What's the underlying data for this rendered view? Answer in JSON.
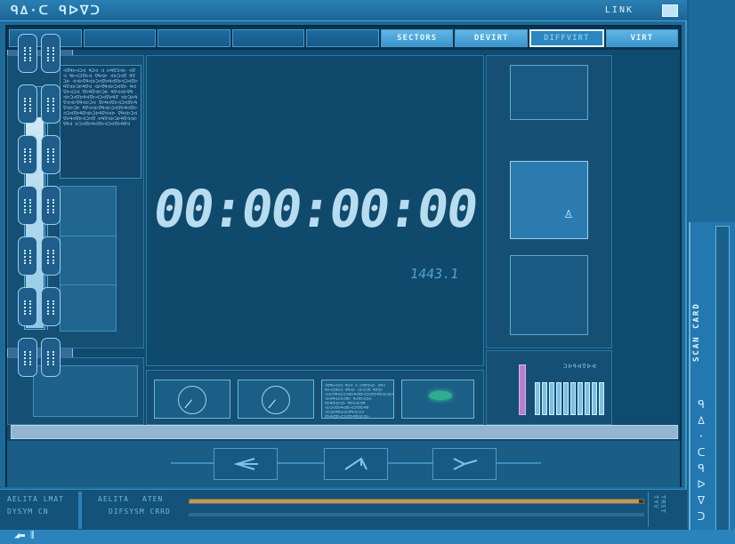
{
  "titlebar": {
    "glyphs_left": "ᑫ∆·ᑕ ᑫᐅᐁᑐ",
    "link_label": "LINK"
  },
  "tabs": [
    {
      "label": "",
      "state": "empty"
    },
    {
      "label": "",
      "state": "empty"
    },
    {
      "label": "",
      "state": "empty"
    },
    {
      "label": "",
      "state": "empty"
    },
    {
      "label": "",
      "state": "empty"
    },
    {
      "label": "SECTORS",
      "state": "lit"
    },
    {
      "label": "DEVIRT",
      "state": "lit"
    },
    {
      "label": "DIFFVIRT",
      "state": "active"
    },
    {
      "label": "VIRT",
      "state": "lit"
    }
  ],
  "left": {
    "gauge_level": 0.87,
    "data_text": "ᐊᐁᑫᐅᐊᑐᐊ ᑫᑐᐊ ᐊ ᐅᑫᐁᑐᐊᐅ ᐊᐁᐊ ᑫᐅᐊᑐᐁᐅᐊ ᐁᑫᐊᐅ ᐊᐅᑐᐊᐁ ᑫᐁᑐᐅ ᐊᐊᐅᐁᑫᐊᐅᑐᐊᐁᐅᑫᐊᐁᐅᐊᑐᐊᐁᐅᑫᐁᐊᐅᑐᐅᑫᐁᐊ ᐊᐅᐁᑫᐊᐅᑐᐊᐁᐅ ᑫᐊᐁᐅᐊᑐᐊ ᐁᐅᑫᐁᐊᐅᑐᐅ ᑫᐁᐊᐊᐅᐁᑫ ᐊᐅᑐᐊᐁᐅᑫᐊᐁᐅᐊᑐᐊᐁᐅᑫᐁ ᐊᐅᑐᐅᑫᐁᐊᐊᐅᐁᑫᐊᐅᑐᐊ ᐁᐅᑫᐊᐁᐅᐊᑐᐊᐁᐅᑫᐁᐊᐅᑐᐅ ᑫᐁᐊᐊᐅᐁᑫᐊᐅᑐᐊᐁᐅᑫᐊᐁᐅ ᐊᑐᐊᐁᐅᑫᐁᐊᐅᑐᐅᑫᐁᐊᐊᐅ ᐁᑫᐊᐅᑐᐊᐁᐅᑫᐊᐁᐅᐊᑐᐊᐁ ᐅᑫᐁᐊᐅᑐᐅᑫᐁᐊᐊᐅᐁᑫᐊ ᐅᑐᐊᐁᐅᑫᐊᐁᐅᐊᑐᐊᐁᐅᑫᐁᐊ"
  },
  "center": {
    "timer": "00:00:00:00",
    "sub_value": "1443.1"
  },
  "right": {
    "label": "ᑐᐅᑫᐊᐁᐅᐊ",
    "bars": [
      0.62,
      0.62,
      0.62,
      0.62,
      0.62,
      0.62,
      0.62,
      0.62,
      0.62,
      0.62
    ],
    "pink_level": 0.95
  },
  "footer": {
    "line1_left": "AELITA LMAT",
    "line2_left": "DYSYM CN",
    "line1_mid": "AELITA",
    "line1_right": "ATEN",
    "line2_mid": "DIFSYSM CRRD",
    "progress": 0.99,
    "end_text": "TRST TYV"
  },
  "sidebar": {
    "label": "SCAN CARD",
    "glyph": "ᑫ ∆ · ᑕ ᑫ ᐅ ᐁ ᑐ"
  },
  "bottom_left_glyph": "◢▬ ⫼"
}
